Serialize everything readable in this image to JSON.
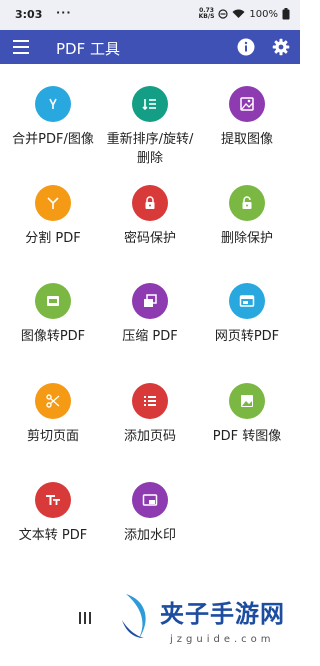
{
  "status_bar": {
    "time": "3:03",
    "dots": "···",
    "net_speed": "0.73",
    "net_unit": "KB/S",
    "battery": "100%"
  },
  "app_bar": {
    "title": "PDF 工具",
    "menu_icon": "hamburger-menu-icon",
    "info_icon": "info-icon",
    "settings_icon": "gear-icon",
    "color": "#3f51b5"
  },
  "tools": [
    {
      "label": "合并PDF/图像",
      "icon": "merge-icon",
      "color": "#29a8e0"
    },
    {
      "label": "重新排序/旋转/删除",
      "icon": "reorder-icon",
      "color": "#139e85"
    },
    {
      "label": "提取图像",
      "icon": "extract-image-icon",
      "color": "#8e3ab0"
    },
    {
      "label": "分割 PDF",
      "icon": "split-icon",
      "color": "#f59a14"
    },
    {
      "label": "密码保护",
      "icon": "lock-icon",
      "color": "#d83a3a"
    },
    {
      "label": "删除保护",
      "icon": "unlock-icon",
      "color": "#7bb843"
    },
    {
      "label": "图像转PDF",
      "icon": "image-to-pdf-icon",
      "color": "#7bb843"
    },
    {
      "label": "压缩 PDF",
      "icon": "compress-icon",
      "color": "#8e3ab0"
    },
    {
      "label": "网页转PDF",
      "icon": "web-page-icon",
      "color": "#29a8e0"
    },
    {
      "label": "剪切页面",
      "icon": "scissors-icon",
      "color": "#f59a14"
    },
    {
      "label": "添加页码",
      "icon": "page-number-icon",
      "color": "#d83a3a"
    },
    {
      "label": "PDF 转图像",
      "icon": "pdf-to-image-icon",
      "color": "#7bb843"
    },
    {
      "label": "文本转 PDF",
      "icon": "text-icon",
      "color": "#d83a3a"
    },
    {
      "label": "添加水印",
      "icon": "watermark-icon",
      "color": "#8e3ab0"
    }
  ],
  "watermark": {
    "site_name": "夹子手游网",
    "site_domain": "jzguide.com"
  }
}
